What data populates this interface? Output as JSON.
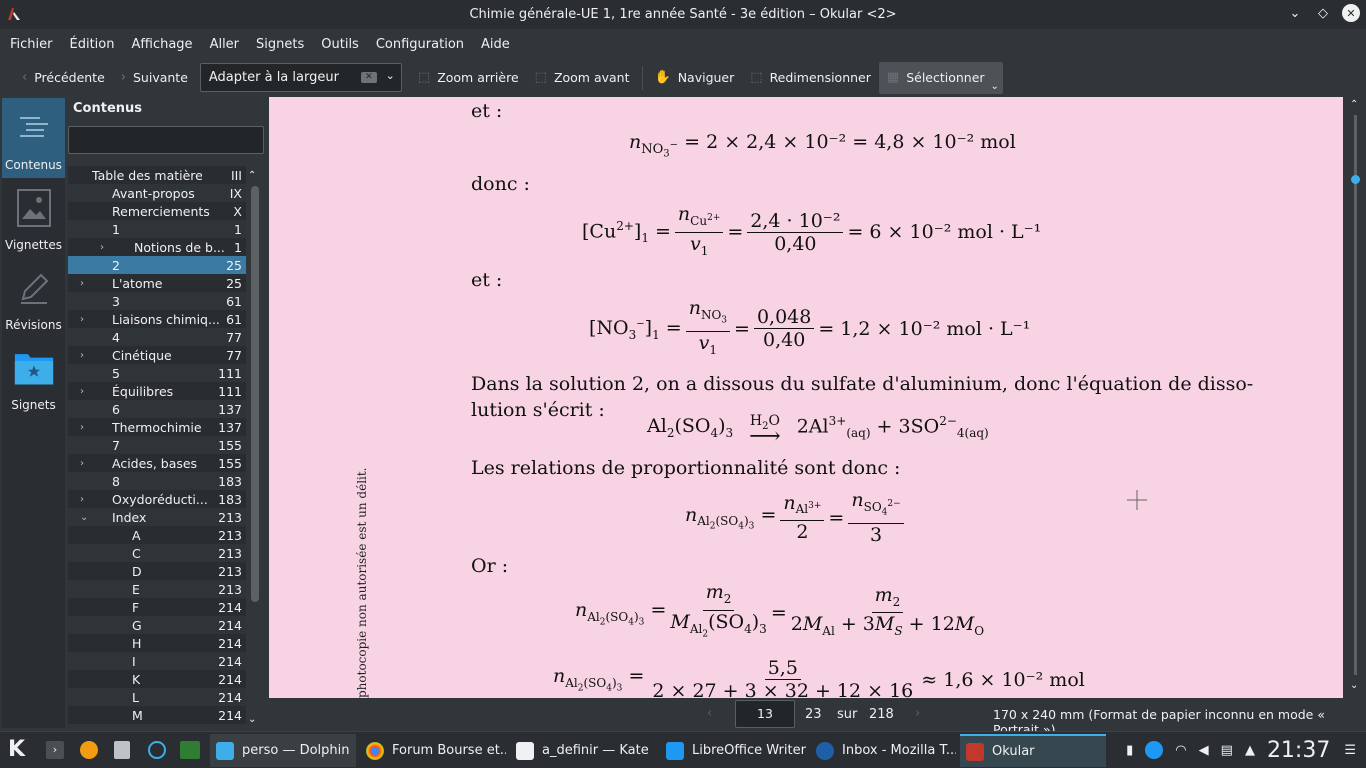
{
  "window": {
    "title": "Chimie générale-UE 1, 1re année Santé - 3e édition – Okular <2>"
  },
  "menu": [
    "Fichier",
    "Édition",
    "Affichage",
    "Aller",
    "Signets",
    "Outils",
    "Configuration",
    "Aide"
  ],
  "toolbar": {
    "prev": "Précédente",
    "next": "Suivante",
    "zoom_mode": "Adapter à la largeur",
    "zoom_out": "Zoom arrière",
    "zoom_in": "Zoom avant",
    "browse": "Naviguer",
    "resize": "Redimensionner",
    "select": "Sélectionner"
  },
  "sidebar": {
    "items": [
      "Contenus",
      "Vignettes",
      "Révisions",
      "Signets"
    ]
  },
  "panel": {
    "title": "Contenus",
    "search_placeholder": ""
  },
  "toc": [
    {
      "label": "Table des matières",
      "page": "III",
      "level": 0,
      "exp": "v"
    },
    {
      "label": "Avant-propos",
      "page": "IX",
      "level": 1,
      "exp": ""
    },
    {
      "label": "Remerciements",
      "page": "X",
      "level": 1,
      "exp": ""
    },
    {
      "label": "1",
      "page": "1",
      "level": 1,
      "exp": ""
    },
    {
      "label": "Notions de b...",
      "page": "1",
      "level": 2,
      "exp": ">"
    },
    {
      "label": "2",
      "page": "25",
      "level": 1,
      "exp": "",
      "sel": true
    },
    {
      "label": "L'atome",
      "page": "25",
      "level": 1,
      "exp": ">"
    },
    {
      "label": "3",
      "page": "61",
      "level": 1,
      "exp": ""
    },
    {
      "label": "Liaisons chimiq...",
      "page": "61",
      "level": 1,
      "exp": ">"
    },
    {
      "label": "4",
      "page": "77",
      "level": 1,
      "exp": ""
    },
    {
      "label": "Cinétique",
      "page": "77",
      "level": 1,
      "exp": ">"
    },
    {
      "label": "5",
      "page": "111",
      "level": 1,
      "exp": ""
    },
    {
      "label": "Équilibres",
      "page": "111",
      "level": 1,
      "exp": ">"
    },
    {
      "label": "6",
      "page": "137",
      "level": 1,
      "exp": ""
    },
    {
      "label": "Thermochimie",
      "page": "137",
      "level": 1,
      "exp": ">"
    },
    {
      "label": "7",
      "page": "155",
      "level": 1,
      "exp": ""
    },
    {
      "label": "Acides, bases",
      "page": "155",
      "level": 1,
      "exp": ">"
    },
    {
      "label": "8",
      "page": "183",
      "level": 1,
      "exp": ""
    },
    {
      "label": "Oxydoréducti...",
      "page": "183",
      "level": 1,
      "exp": ">"
    },
    {
      "label": "Index",
      "page": "213",
      "level": 1,
      "exp": "v"
    },
    {
      "label": "A",
      "page": "213",
      "level": 2,
      "exp": ""
    },
    {
      "label": "C",
      "page": "213",
      "level": 2,
      "exp": ""
    },
    {
      "label": "D",
      "page": "213",
      "level": 2,
      "exp": ""
    },
    {
      "label": "E",
      "page": "213",
      "level": 2,
      "exp": ""
    },
    {
      "label": "F",
      "page": "214",
      "level": 2,
      "exp": ""
    },
    {
      "label": "G",
      "page": "214",
      "level": 2,
      "exp": ""
    },
    {
      "label": "H",
      "page": "214",
      "level": 2,
      "exp": ""
    },
    {
      "label": "I",
      "page": "214",
      "level": 2,
      "exp": ""
    },
    {
      "label": "K",
      "page": "214",
      "level": 2,
      "exp": ""
    },
    {
      "label": "L",
      "page": "214",
      "level": 2,
      "exp": ""
    },
    {
      "label": "M",
      "page": "214",
      "level": 2,
      "exp": ""
    }
  ],
  "document": {
    "et1": "et :",
    "donc": "donc :",
    "et2": "et :",
    "para1": "Dans la solution 2, on a dissous du sulfate d'aluminium, donc l'équation de disso-",
    "para2": "lution s'écrit :",
    "relations": "Les relations de proportionnalité sont donc :",
    "or": "Or :",
    "margin_text": "photocopie non autorisée est un délit.",
    "eq1": "= 2 × 2,4 × 10⁻² = 4,8 × 10⁻² mol",
    "eq2_num": "2,4 · 10⁻²",
    "eq2_den": "0,40",
    "eq2_res": "= 6 × 10⁻² mol · L⁻¹",
    "eq3_num": "0,048",
    "eq3_den": "0,40",
    "eq3_res": "= 1,2 × 10⁻² mol · L⁻¹",
    "eq6_num": "5,5",
    "eq6_den": "2 × 27 + 3 × 32 + 12 × 16",
    "eq6_res": "≈ 1,6 × 10⁻² mol"
  },
  "status": {
    "page": "13",
    "page_label": "23",
    "of": "sur",
    "total": "218",
    "paper": "170 x 240 mm (Format de papier inconnu en mode « Portrait »)"
  },
  "taskbar": {
    "tasks": [
      "perso — Dolphin",
      "Forum Bourse et...",
      "a_definir — Kate",
      "LibreOffice Writer",
      "Inbox - Mozilla T...",
      "Okular"
    ],
    "clock": "21:37"
  },
  "colors": {
    "accent": "#3daee9",
    "page_bg": "#f7d3e4",
    "selection": "#3b7aa3"
  }
}
